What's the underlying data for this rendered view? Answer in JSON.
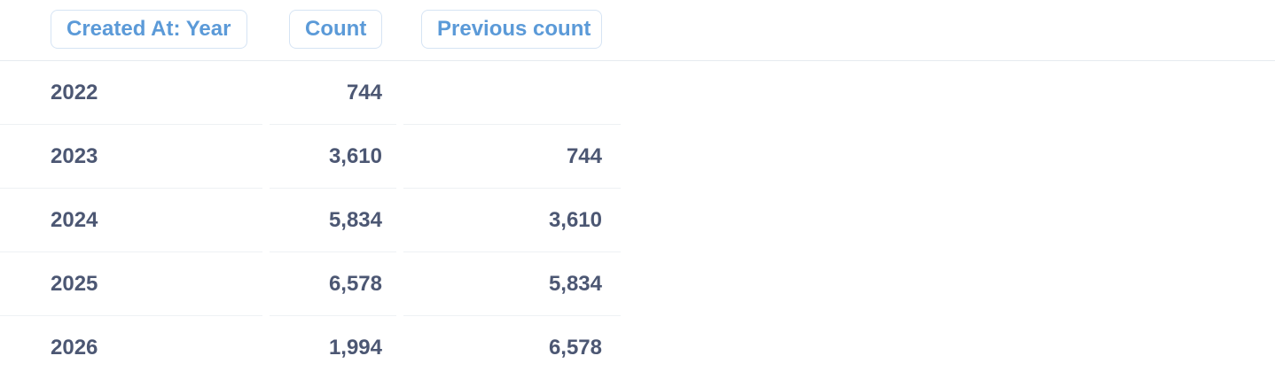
{
  "columns": {
    "year_label": "Created At: Year",
    "count_label": "Count",
    "previous_label": "Previous count"
  },
  "rows": [
    {
      "year": "2022",
      "count": "744",
      "previous": ""
    },
    {
      "year": "2023",
      "count": "3,610",
      "previous": "744"
    },
    {
      "year": "2024",
      "count": "5,834",
      "previous": "3,610"
    },
    {
      "year": "2025",
      "count": "6,578",
      "previous": "5,834"
    },
    {
      "year": "2026",
      "count": "1,994",
      "previous": "6,578"
    }
  ],
  "colors": {
    "header_text": "#5b9ad8",
    "header_border": "#d6e4f4",
    "cell_text": "#4c5773",
    "divider": "#eef1f4"
  }
}
